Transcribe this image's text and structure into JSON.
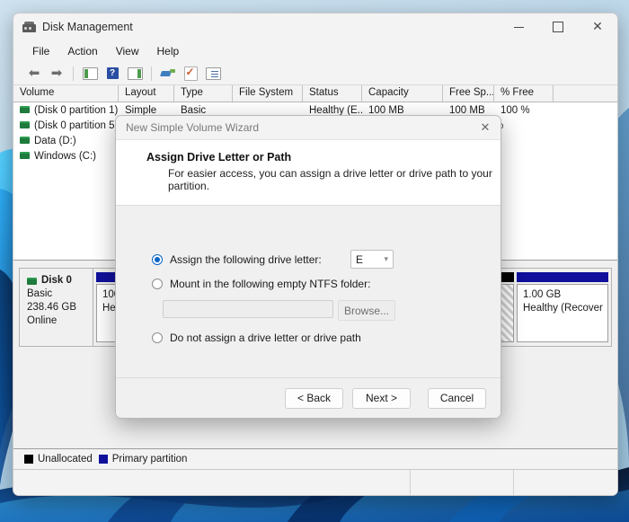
{
  "window": {
    "title": "Disk Management",
    "icon": "disk-management-icon",
    "controls": {
      "minimize": "─",
      "maximize": "□",
      "close": "✕"
    }
  },
  "menubar": {
    "items": [
      "File",
      "Action",
      "View",
      "Help"
    ]
  },
  "toolbar": {
    "items": [
      {
        "name": "back-icon",
        "glyph": "⬅"
      },
      {
        "name": "forward-icon",
        "glyph": "➡"
      },
      {
        "name": "up-one-level-icon",
        "glyph": ""
      },
      {
        "name": "help-icon",
        "glyph": "?"
      },
      {
        "name": "show-hide-console-tree-icon",
        "glyph": ""
      },
      {
        "name": "rescan-disks-icon",
        "glyph": ""
      },
      {
        "name": "properties-icon",
        "glyph": "✓"
      },
      {
        "name": "list-view-icon",
        "glyph": ""
      }
    ]
  },
  "volume_list": {
    "columns": [
      {
        "label": "Volume",
        "width": 117
      },
      {
        "label": "Layout",
        "width": 62
      },
      {
        "label": "Type",
        "width": 65
      },
      {
        "label": "File System",
        "width": 78
      },
      {
        "label": "Status",
        "width": 66
      },
      {
        "label": "Capacity",
        "width": 90
      },
      {
        "label": "Free Sp...",
        "width": 57
      },
      {
        "label": "% Free",
        "width": 66
      }
    ],
    "rows": [
      {
        "volume": "(Disk 0 partition 1)",
        "layout": "Simple",
        "type": "Basic",
        "file_system": "",
        "status": "Healthy (E...",
        "capacity": "100 MB",
        "free_space": "100 MB",
        "percent_free": "100 %"
      },
      {
        "volume": "(Disk 0 partition 5)",
        "layout": "",
        "type": "",
        "file_system": "",
        "status": "",
        "capacity": "",
        "free_space": "",
        "percent_free": "% "
      },
      {
        "volume": "Data (D:)",
        "layout": "",
        "type": "",
        "file_system": "",
        "status": "",
        "capacity": "",
        "free_space": "",
        "percent_free": ""
      },
      {
        "volume": "Windows (C:)",
        "layout": "",
        "type": "",
        "file_system": "",
        "status": "",
        "capacity": "",
        "free_space": "",
        "percent_free": ""
      }
    ]
  },
  "disk_view": {
    "disk": {
      "name": "Disk 0",
      "type": "Basic",
      "size": "238.46 GB",
      "status": "Online"
    },
    "partitions": [
      {
        "kind": "primary",
        "size": "100 MB",
        "status": "He",
        "cap_color": "#10109c"
      },
      {
        "kind": "unallocated",
        "size": "",
        "status": "",
        "cap_color": "#000000"
      },
      {
        "kind": "primary",
        "size": "1.00 GB",
        "status": "Healthy (Recover",
        "cap_color": "#10109c"
      }
    ]
  },
  "legend": {
    "items": [
      {
        "label": "Unallocated",
        "color": "#000000",
        "swatch": "black"
      },
      {
        "label": "Primary partition",
        "color": "#10109c",
        "swatch": "blue"
      }
    ]
  },
  "wizard": {
    "title": "New Simple Volume Wizard",
    "close_glyph": "✕",
    "heading": "Assign Drive Letter or Path",
    "subheading": "For easier access, you can assign a drive letter or drive path to your partition.",
    "options": [
      {
        "id": "assign-drive-letter",
        "label": "Assign the following drive letter:",
        "selected": true
      },
      {
        "id": "mount-ntfs-folder",
        "label": "Mount in the following empty NTFS folder:",
        "selected": false
      },
      {
        "id": "no-drive-letter",
        "label": "Do not assign a drive letter or drive path",
        "selected": false
      }
    ],
    "drive_letter": {
      "value": "E",
      "chevron": "⌄"
    },
    "mount_path": {
      "value": "",
      "placeholder": ""
    },
    "browse_label": "Browse...",
    "buttons": {
      "back": "< Back",
      "next": "Next >",
      "cancel": "Cancel"
    }
  }
}
